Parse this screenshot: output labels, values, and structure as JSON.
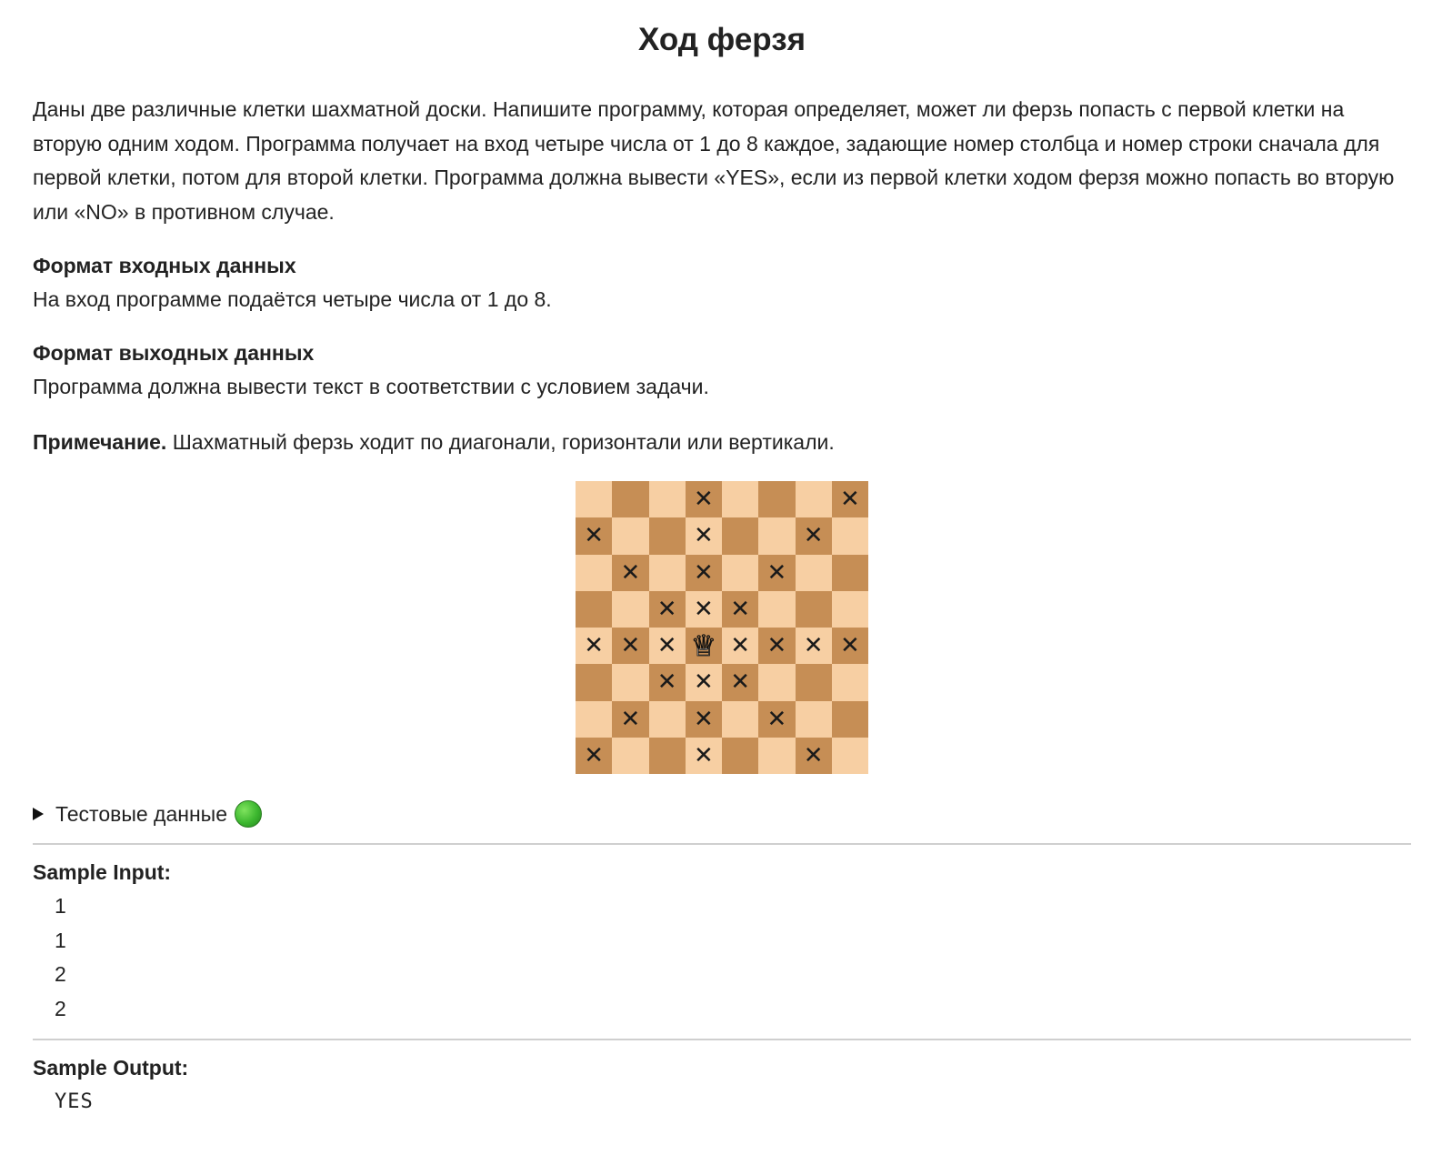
{
  "title": "Ход ферзя",
  "statement": "Даны две различные клетки шахматной доски. Напишите программу,  которая определяет, может ли ферзь попасть с первой клетки на вторую одним ходом. Программа получает на вход четыре числа от 1 до 8 каждое, задающие номер столбца и номер строки сначала для первой клетки, потом для второй клетки. Программа должна вывести «YES», если из первой клетки ходом ферзя можно попасть во вторую или «NO» в противном случае.",
  "input_format": {
    "heading": "Формат входных данных",
    "text": "На вход программе подаётся четыре числа от 1 до 8."
  },
  "output_format": {
    "heading": "Формат выходных данных",
    "text": "Программа должна вывести текст в соответствии с условием задачи."
  },
  "note": {
    "label": "Примечание.",
    "text": " Шахматный ферзь ходит по диагонали, горизонтали или вертикали."
  },
  "board": {
    "light_color": "#f7cfa3",
    "dark_color": "#c68e55",
    "queen_icon": "white-queen",
    "queen_glyph": "♕",
    "mark_glyph": "✕",
    "rows": [
      [
        0,
        0,
        0,
        1,
        0,
        0,
        0,
        1
      ],
      [
        1,
        0,
        0,
        1,
        0,
        0,
        1,
        0
      ],
      [
        0,
        1,
        0,
        1,
        0,
        1,
        0,
        0
      ],
      [
        0,
        0,
        1,
        1,
        1,
        0,
        0,
        0
      ],
      [
        1,
        1,
        1,
        2,
        1,
        1,
        1,
        1
      ],
      [
        0,
        0,
        1,
        1,
        1,
        0,
        0,
        0
      ],
      [
        0,
        1,
        0,
        1,
        0,
        1,
        0,
        0
      ],
      [
        1,
        0,
        0,
        1,
        0,
        0,
        1,
        0
      ]
    ]
  },
  "test_data": {
    "label": "Тестовые данные",
    "status_icon": "green-circle",
    "status_color": "#3cb72f"
  },
  "sample_input": {
    "heading": "Sample Input:",
    "lines": [
      "1",
      "1",
      "2",
      "2"
    ]
  },
  "sample_output": {
    "heading": "Sample Output:",
    "lines": [
      "YES"
    ]
  }
}
